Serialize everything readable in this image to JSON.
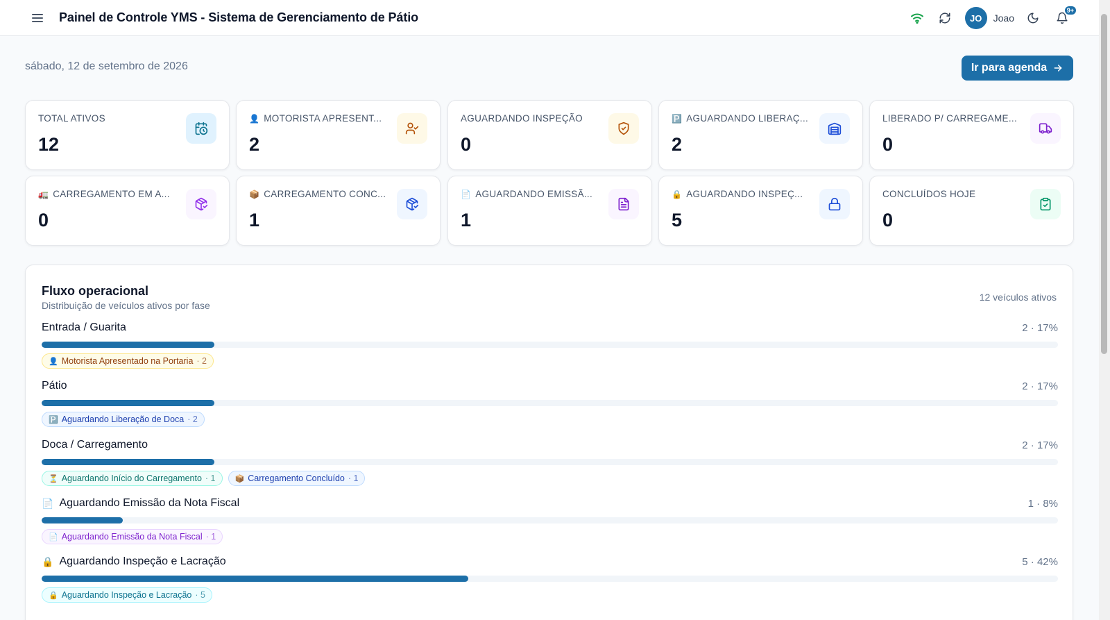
{
  "header": {
    "title": "Painel de Controle YMS - Sistema de Gerenciamento de Pátio",
    "user_initials": "JO",
    "user_name": "Joao",
    "notifications_badge": "9+"
  },
  "date": "sábado, 12 de setembro de 2026",
  "agenda_button": "Ir para agenda",
  "stat_cards": [
    {
      "label": "TOTAL ATIVOS",
      "emoji": "",
      "value": "12",
      "icon": "calendar-clock-icon",
      "color": "#0e7490",
      "bg": "#e0f2fe"
    },
    {
      "label": "MOTORISTA APRESENT...",
      "emoji": "👤",
      "value": "2",
      "icon": "user-check-icon",
      "color": "#b45309",
      "bg": "#fef9e7"
    },
    {
      "label": "AGUARDANDO INSPEÇÃO",
      "emoji": "",
      "value": "0",
      "icon": "shield-check-icon",
      "color": "#b45309",
      "bg": "#fef9e7"
    },
    {
      "label": "AGUARDANDO LIBERAÇ...",
      "emoji": "🅿️",
      "value": "2",
      "icon": "warehouse-icon",
      "color": "#1d4ed8",
      "bg": "#eff6ff"
    },
    {
      "label": "LIBERADO P/ CARREGAME...",
      "emoji": "",
      "value": "0",
      "icon": "truck-icon",
      "color": "#7e22ce",
      "bg": "#faf5ff"
    },
    {
      "label": "CARREGAMENTO EM A...",
      "emoji": "🚛",
      "value": "0",
      "icon": "package-check-icon",
      "color": "#9333ea",
      "bg": "#faf5ff"
    },
    {
      "label": "CARREGAMENTO CONC...",
      "emoji": "📦",
      "value": "1",
      "icon": "package-check-icon",
      "color": "#1d4ed8",
      "bg": "#eff6ff"
    },
    {
      "label": "AGUARDANDO EMISSÃ...",
      "emoji": "📄",
      "value": "1",
      "icon": "file-text-icon",
      "color": "#7e22ce",
      "bg": "#faf5ff"
    },
    {
      "label": "AGUARDANDO INSPEÇ...",
      "emoji": "🔒",
      "value": "5",
      "icon": "lock-icon",
      "color": "#1d4ed8",
      "bg": "#eff6ff"
    },
    {
      "label": "CONCLUÍDOS HOJE",
      "emoji": "",
      "value": "0",
      "icon": "clipboard-check-icon",
      "color": "#059669",
      "bg": "#ecfdf5"
    }
  ],
  "flow": {
    "title": "Fluxo operacional",
    "subtitle": "Distribuição de veículos ativos por fase",
    "count": "12 veículos ativos",
    "phases": [
      {
        "name": "Entrada / Guarita",
        "emoji": "",
        "stat": "2 · 17%",
        "fraction": 0.17,
        "chips": [
          {
            "emoji": "👤",
            "label": "Motorista Apresentado na Portaria",
            "count": "· 2",
            "style": "yellow"
          }
        ]
      },
      {
        "name": "Pátio",
        "emoji": "",
        "stat": "2 · 17%",
        "fraction": 0.17,
        "chips": [
          {
            "emoji": "🅿️",
            "label": "Aguardando Liberação de Doca",
            "count": "· 2",
            "style": "blue"
          }
        ]
      },
      {
        "name": "Doca / Carregamento",
        "emoji": "",
        "stat": "2 · 17%",
        "fraction": 0.17,
        "chips": [
          {
            "emoji": "⏳",
            "label": "Aguardando Início do Carregamento",
            "count": "· 1",
            "style": "teal"
          },
          {
            "emoji": "📦",
            "label": "Carregamento Concluído",
            "count": "· 1",
            "style": "blue"
          }
        ]
      },
      {
        "name": "Aguardando Emissão da Nota Fiscal",
        "emoji": "📄",
        "stat": "1 · 8%",
        "fraction": 0.08,
        "chips": [
          {
            "emoji": "📄",
            "label": "Aguardando Emissão da Nota Fiscal",
            "count": "· 1",
            "style": "purple"
          }
        ]
      },
      {
        "name": "Aguardando Inspeção e Lacração",
        "emoji": "🔒",
        "stat": "5 · 42%",
        "fraction": 0.42,
        "chips": [
          {
            "emoji": "🔒",
            "label": "Aguardando Inspeção e Lacração",
            "count": "· 5",
            "style": "cyan"
          }
        ]
      }
    ]
  }
}
